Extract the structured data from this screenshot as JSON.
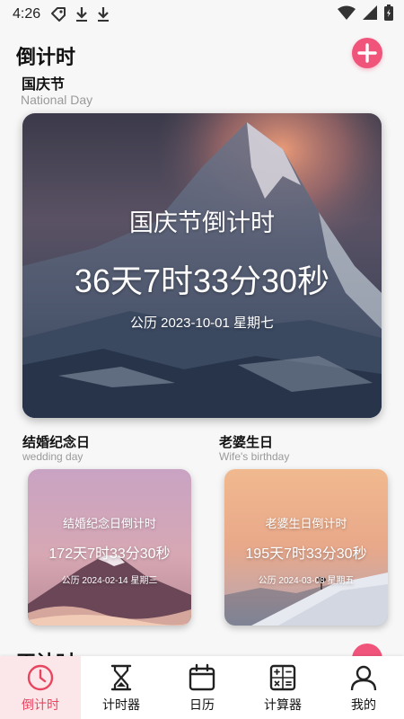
{
  "status_bar": {
    "time": "4:26",
    "icons": [
      "tag-icon",
      "download-icon",
      "download-icon",
      "wifi-icon",
      "signal-icon",
      "battery-icon"
    ]
  },
  "header": {
    "title": "倒计时",
    "add_icon": "plus-icon"
  },
  "featured": {
    "name": "国庆节",
    "subtitle": "National Day",
    "card_title": "国庆节倒计时",
    "countdown": "36天7时33分30秒",
    "date": "公历 2023-10-01 星期七"
  },
  "small_cards": [
    {
      "name": "结婚纪念日",
      "subtitle": "wedding day",
      "card_title": "结婚纪念日倒计时",
      "countdown": "172天7时33分30秒",
      "date": "公历 2024-02-14 星期三"
    },
    {
      "name": "老婆生日",
      "subtitle": "Wife's birthday",
      "card_title": "老婆生日倒计时",
      "countdown": "195天7时33分30秒",
      "date": "公历 2024-03-08 星期五"
    }
  ],
  "next_section": {
    "title": "正计时"
  },
  "bottom_nav": [
    {
      "label": "倒计时",
      "icon": "clock-icon",
      "active": true
    },
    {
      "label": "计时器",
      "icon": "hourglass-icon",
      "active": false
    },
    {
      "label": "日历",
      "icon": "calendar-icon",
      "active": false
    },
    {
      "label": "计算器",
      "icon": "calculator-icon",
      "active": false
    },
    {
      "label": "我的",
      "icon": "user-icon",
      "active": false
    }
  ],
  "colors": {
    "accent": "#f0547a",
    "active_nav": "#e8455f",
    "active_nav_bg": "#fbe7ea"
  }
}
